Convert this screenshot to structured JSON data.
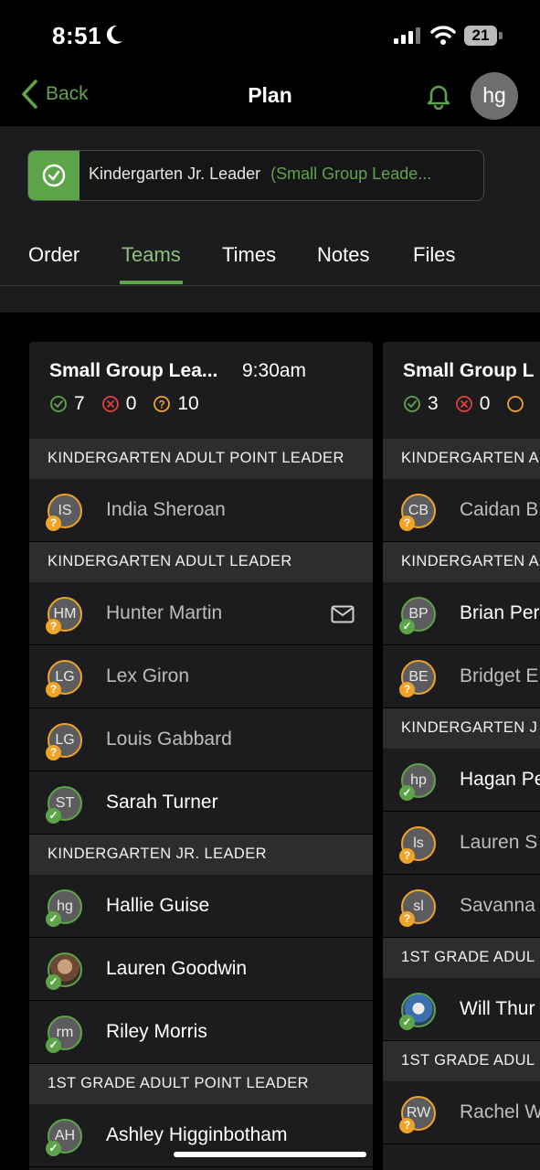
{
  "status": {
    "time": "8:51",
    "battery": "21"
  },
  "nav": {
    "back_label": "Back",
    "title": "Plan",
    "avatar_initials": "hg"
  },
  "position": {
    "name": "Kindergarten Jr. Leader",
    "group": "(Small Group Leade..."
  },
  "tabs": [
    "Order",
    "Teams",
    "Times",
    "Notes",
    "Files"
  ],
  "active_tab": "Teams",
  "columns": [
    {
      "title": "Small Group Lea...",
      "time": "9:30am",
      "confirmed": "7",
      "declined": "0",
      "pending": "10",
      "sections": [
        {
          "name": "KINDERGARTEN ADULT POINT LEADER",
          "people": [
            {
              "initials": "IS",
              "name": "India Sheroan",
              "status": "pending"
            }
          ]
        },
        {
          "name": "KINDERGARTEN ADULT LEADER",
          "people": [
            {
              "initials": "HM",
              "name": "Hunter Martin",
              "status": "pending"
            },
            {
              "initials": "LG",
              "name": "Lex Giron",
              "status": "pending"
            },
            {
              "initials": "LG",
              "name": "Louis Gabbard",
              "status": "pending"
            },
            {
              "initials": "ST",
              "name": "Sarah Turner",
              "status": "confirmed"
            }
          ]
        },
        {
          "name": "KINDERGARTEN JR. LEADER",
          "people": [
            {
              "initials": "hg",
              "name": "Hallie Guise",
              "status": "confirmed"
            },
            {
              "initials": "",
              "name": "Lauren Goodwin",
              "status": "confirmed"
            },
            {
              "initials": "rm",
              "name": "Riley Morris",
              "status": "confirmed"
            }
          ]
        },
        {
          "name": "1ST GRADE ADULT POINT LEADER",
          "people": [
            {
              "initials": "AH",
              "name": "Ashley Higginbotham",
              "status": "confirmed"
            }
          ]
        }
      ]
    },
    {
      "title": "Small Group L",
      "confirmed": "3",
      "declined": "0",
      "sections": [
        {
          "name": "KINDERGARTEN A",
          "people": [
            {
              "initials": "CB",
              "name": "Caidan B",
              "status": "pending"
            }
          ]
        },
        {
          "name": "KINDERGARTEN A",
          "people": [
            {
              "initials": "BP",
              "name": "Brian Per",
              "status": "confirmed"
            },
            {
              "initials": "BE",
              "name": "Bridget E",
              "status": "pending"
            }
          ]
        },
        {
          "name": "KINDERGARTEN J",
          "people": [
            {
              "initials": "hp",
              "name": "Hagan Pe",
              "status": "confirmed"
            },
            {
              "initials": "ls",
              "name": "Lauren S",
              "status": "pending"
            },
            {
              "initials": "sl",
              "name": "Savanna",
              "status": "pending"
            }
          ]
        },
        {
          "name": "1ST GRADE ADUL",
          "people": [
            {
              "initials": "",
              "name": "Will Thur",
              "status": "confirmed"
            }
          ]
        },
        {
          "name": "1ST GRADE ADUL",
          "people": [
            {
              "initials": "RW",
              "name": "Rachel W",
              "status": "pending"
            }
          ]
        }
      ]
    }
  ],
  "colors": {
    "accent": "#5ea54a",
    "pending": "#f0a427",
    "declined": "#e0413a",
    "background": "#000000",
    "surface": "#1c1c1e"
  }
}
